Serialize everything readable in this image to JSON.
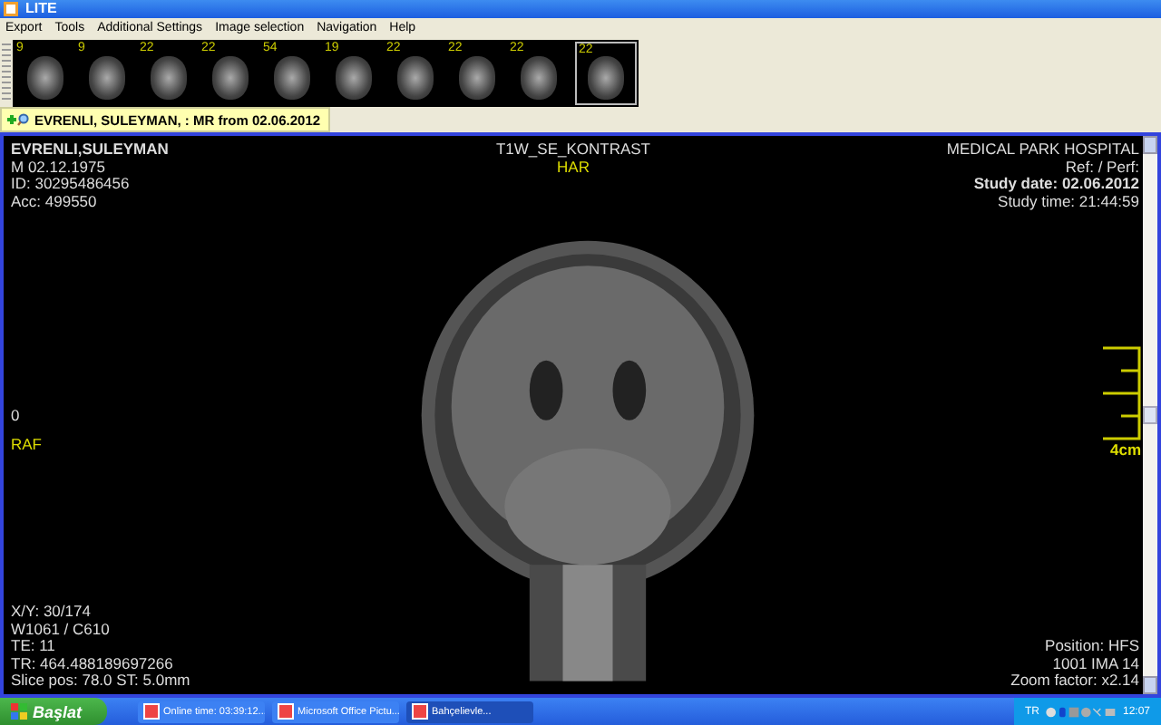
{
  "window": {
    "title": "LITE"
  },
  "menu": [
    "Export",
    "Tools",
    "Additional Settings",
    "Image selection",
    "Navigation",
    "Help"
  ],
  "thumbnails": [
    {
      "label": "9",
      "selected": false
    },
    {
      "label": "9",
      "selected": false
    },
    {
      "label": "22",
      "selected": false
    },
    {
      "label": "22",
      "selected": false
    },
    {
      "label": "54",
      "selected": false
    },
    {
      "label": "19",
      "selected": false
    },
    {
      "label": "22",
      "selected": false
    },
    {
      "label": "22",
      "selected": false
    },
    {
      "label": "22",
      "selected": false
    },
    {
      "label": "22",
      "selected": true
    }
  ],
  "study_tab": {
    "label": "EVRENLI, SULEYMAN, : MR from 02.06.2012"
  },
  "viewer": {
    "series_title": "T1W_SE_KONTRAST",
    "orientation_top": "HAR",
    "orientation_left_value": "0",
    "orientation_left": "RAF",
    "scale_label": "4cm",
    "top_left": [
      {
        "text": "EVRENLI,SULEYMAN",
        "bold": true
      },
      {
        "text": "M  02.12.1975",
        "bold": false
      },
      {
        "text": "ID: 30295486456",
        "bold": false
      },
      {
        "text": "Acc: 499550",
        "bold": false
      }
    ],
    "top_right": [
      {
        "text": "MEDICAL PARK HOSPITAL",
        "bold": false
      },
      {
        "text": "Ref:  / Perf:",
        "bold": false
      },
      {
        "text": "Study date: 02.06.2012",
        "bold": true
      },
      {
        "text": "Study time: 21:44:59",
        "bold": false
      }
    ],
    "bottom_left": [
      {
        "text": "X/Y: 30/174",
        "bold": false
      },
      {
        "text": "W1061 / C610",
        "bold": false
      },
      {
        "text": "TE: 11",
        "bold": false
      },
      {
        "text": "TR: 464.488189697266",
        "bold": false
      },
      {
        "text": "Slice pos: 78.0  ST: 5.0mm",
        "bold": false
      }
    ],
    "bottom_right": [
      {
        "text": "Position: HFS",
        "bold": false
      },
      {
        "text": "1001 IMA 14",
        "bold": false
      },
      {
        "text": "Zoom factor: x2.14",
        "bold": false
      }
    ]
  },
  "taskbar": {
    "start": "Başlat",
    "tasks": [
      {
        "label": "Online time: 03:39:12...",
        "selected": false
      },
      {
        "label": "Microsoft Office Pictu...",
        "selected": false
      },
      {
        "label": "Bahçelievle...",
        "selected": true
      }
    ],
    "language": "TR",
    "clock": "12:07"
  }
}
